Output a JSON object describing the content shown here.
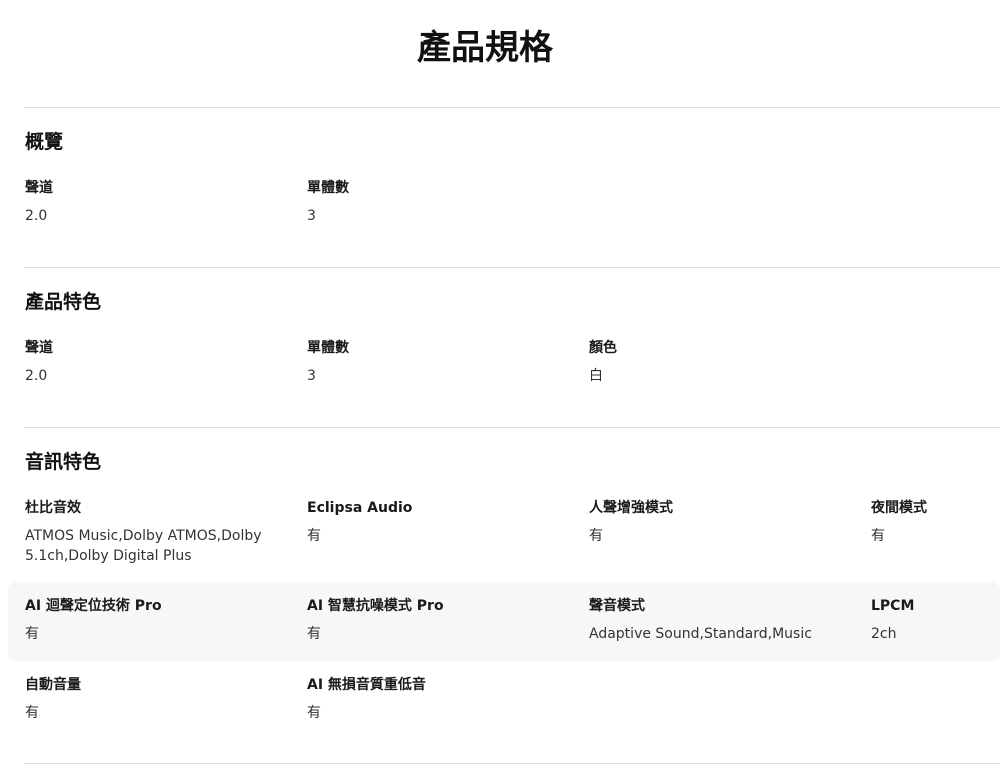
{
  "page_title": "產品規格",
  "sections": [
    {
      "title": "概覽",
      "rows": [
        [
          {
            "label": "聲道",
            "value": "2.0"
          },
          {
            "label": "單體數",
            "value": "3"
          }
        ]
      ]
    },
    {
      "title": "產品特色",
      "rows": [
        [
          {
            "label": "聲道",
            "value": "2.0"
          },
          {
            "label": "單體數",
            "value": "3"
          },
          {
            "label": "顏色",
            "value": "白"
          }
        ]
      ]
    },
    {
      "title": "音訊特色",
      "rows": [
        [
          {
            "label": "杜比音效",
            "value": "ATMOS Music,Dolby ATMOS,Dolby 5.1ch,Dolby Digital Plus"
          },
          {
            "label": "Eclipsa Audio",
            "value": "有"
          },
          {
            "label": "人聲增強模式",
            "value": "有"
          },
          {
            "label": "夜間模式",
            "value": "有"
          }
        ],
        [
          {
            "label": "AI 迴聲定位技術 Pro",
            "value": "有"
          },
          {
            "label": "AI 智慧抗噪模式 Pro",
            "value": "有"
          },
          {
            "label": "聲音模式",
            "value": "Adaptive Sound,Standard,Music"
          },
          {
            "label": "LPCM",
            "value": "2ch"
          }
        ],
        [
          {
            "label": "自動音量",
            "value": "有"
          },
          {
            "label": "AI 無損音質重低音",
            "value": "有"
          }
        ]
      ]
    }
  ]
}
